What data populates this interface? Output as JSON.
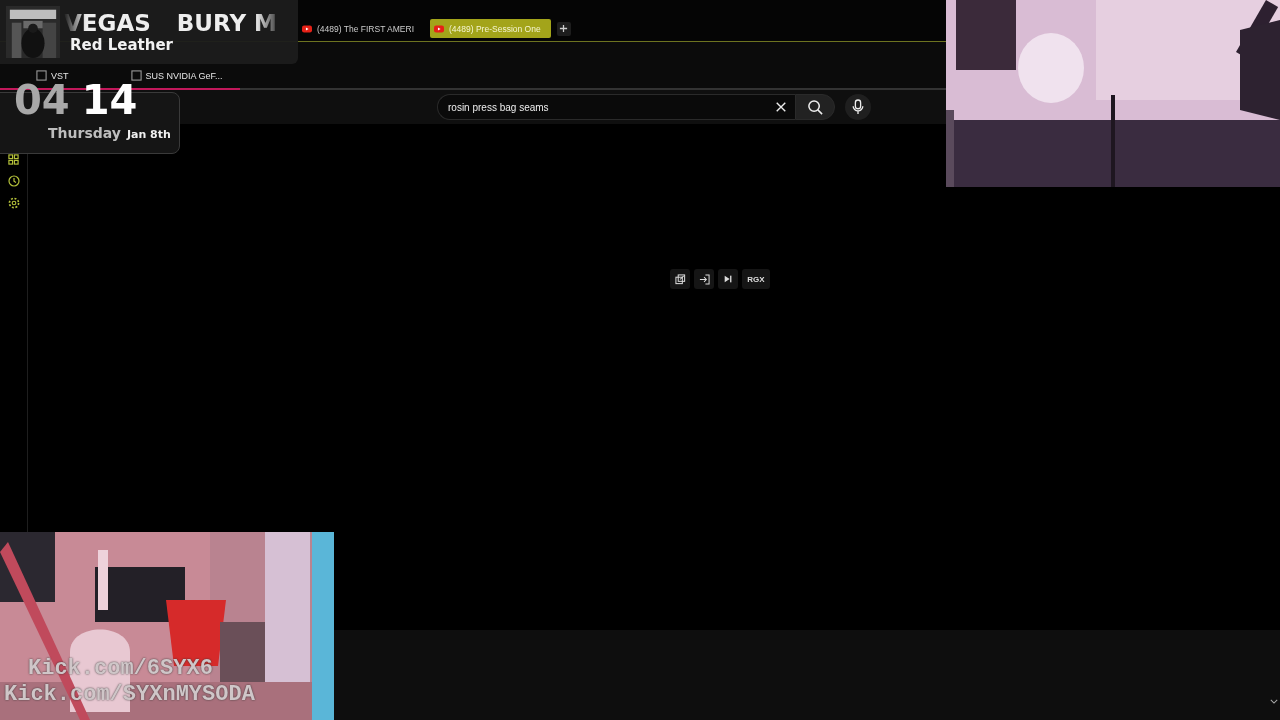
{
  "tabs": [
    {
      "title": "(4489) The FIRST AMERI",
      "selected": false
    },
    {
      "title": "(4489) Pre-Session One",
      "selected": true
    }
  ],
  "bookmarks": [
    {
      "label": "VST"
    },
    {
      "label": "SUS NVIDIA GeF..."
    }
  ],
  "search": {
    "value": "rosin press bag seams"
  },
  "toolbar": {
    "regex_label": "RGX"
  },
  "now_playing": {
    "title_parts": [
      "VEGAS",
      "BURY M"
    ],
    "track": "Red Leather"
  },
  "clock": {
    "hours": "04",
    "minutes": "14",
    "weekday": "Thursday",
    "date": "Jan 8th"
  },
  "overlay_text": [
    "Kick.com/6SYX6",
    "Kick.com/SYXnMYSODA"
  ]
}
